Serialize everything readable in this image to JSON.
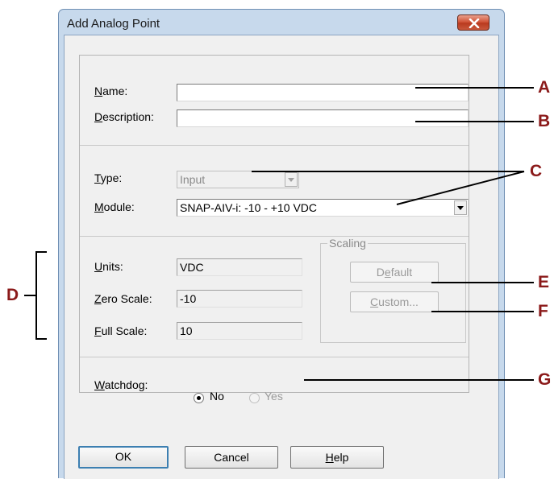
{
  "window": {
    "title": "Add Analog Point"
  },
  "fields": {
    "name": {
      "label_pre": "",
      "label_u": "N",
      "label_post": "ame:",
      "value": ""
    },
    "description": {
      "label_pre": "",
      "label_u": "D",
      "label_post": "escription:",
      "value": ""
    },
    "type": {
      "label_pre": "",
      "label_u": "T",
      "label_post": "ype:",
      "value": "Input"
    },
    "module": {
      "label_pre": "",
      "label_u": "M",
      "label_post": "odule:",
      "value": "SNAP-AIV-i: -10 - +10 VDC"
    },
    "units": {
      "label_pre": "",
      "label_u": "U",
      "label_post": "nits:",
      "value": "VDC"
    },
    "zero_scale": {
      "label_pre": "",
      "label_u": "Z",
      "label_post": "ero Scale:",
      "value": "-10"
    },
    "full_scale": {
      "label_pre": "",
      "label_u": "F",
      "label_post": "ull Scale:",
      "value": "10"
    }
  },
  "scaling": {
    "legend": "Scaling",
    "default_button": {
      "pre": "D",
      "u": "e",
      "post": "fault"
    },
    "custom_button": {
      "pre": "",
      "u": "C",
      "post": "ustom..."
    }
  },
  "watchdog": {
    "label_pre": "",
    "label_u": "W",
    "label_post": "atchdog:",
    "options": [
      {
        "label": "No",
        "checked": true,
        "enabled": true
      },
      {
        "label": "Yes",
        "checked": false,
        "enabled": false
      }
    ]
  },
  "buttons": {
    "ok": "OK",
    "cancel": "Cancel",
    "help": {
      "pre": "",
      "u": "H",
      "post": "elp"
    }
  },
  "callouts": {
    "a": "A",
    "b": "B",
    "c": "C",
    "d": "D",
    "e": "E",
    "f": "F",
    "g": "G",
    "color": "#8b1a1a"
  },
  "icons": {
    "close": "close-x-icon",
    "dropdown": "chevron-down-icon"
  }
}
